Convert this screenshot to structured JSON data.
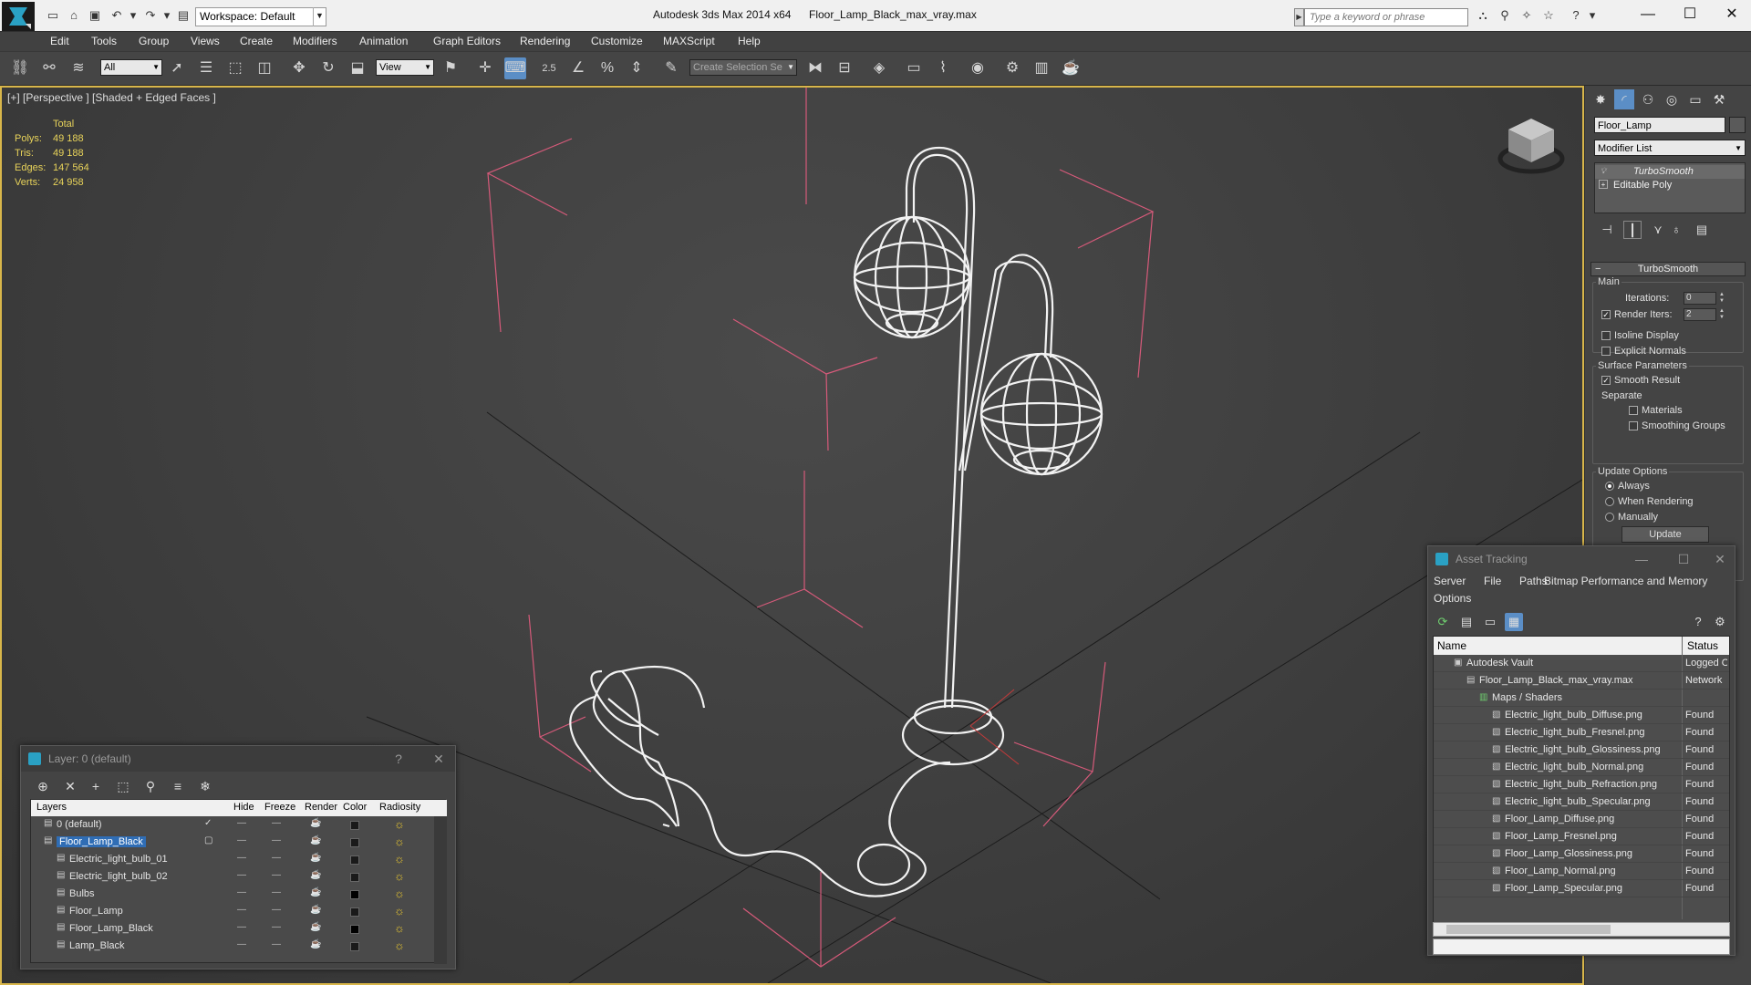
{
  "window": {
    "app_title": "Autodesk 3ds Max  2014 x64",
    "file_title": "Floor_Lamp_Black_max_vray.max",
    "workspace": "Workspace: Default",
    "search_placeholder": "Type a keyword or phrase"
  },
  "menu": [
    "Edit",
    "Tools",
    "Group",
    "Views",
    "Create",
    "Modifiers",
    "Animation",
    "Graph Editors",
    "Rendering",
    "Customize",
    "MAXScript",
    "Help"
  ],
  "toolbar": {
    "selection_filter": "All",
    "ref_coord": "View",
    "snap_label": "2.5",
    "named_selection_placeholder": "Create Selection Se"
  },
  "viewport": {
    "label": "[+] [Perspective ] [Shaded + Edged Faces ]",
    "stats": {
      "header": "Total",
      "rows": [
        {
          "k": "Polys:",
          "v": "49 188"
        },
        {
          "k": "Tris:",
          "v": "49 188"
        },
        {
          "k": "Edges:",
          "v": "147 564"
        },
        {
          "k": "Verts:",
          "v": "24 958"
        }
      ]
    }
  },
  "command_panel": {
    "object_name": "Floor_Lamp",
    "modifier_list": "Modifier List",
    "stack": [
      "TurboSmooth",
      "Editable Poly"
    ],
    "turbosmooth": {
      "title": "TurboSmooth",
      "main_label": "Main",
      "iterations_label": "Iterations:",
      "iterations": "0",
      "render_iters_label": "Render Iters:",
      "render_iters": "2",
      "isoline": "Isoline Display",
      "explicit_normals": "Explicit Normals",
      "surface_params": "Surface Parameters",
      "smooth_result": "Smooth Result",
      "separate": "Separate",
      "materials": "Materials",
      "smoothing_groups": "Smoothing Groups",
      "update_options": "Update Options",
      "always": "Always",
      "when_rendering": "When Rendering",
      "manually": "Manually",
      "update_button": "Update"
    }
  },
  "layer_dialog": {
    "title": "Layer: 0 (default)",
    "help": "?",
    "columns": [
      "Layers",
      "Hide",
      "Freeze",
      "Render",
      "Color",
      "Radiosity"
    ],
    "rows": [
      {
        "name": "0 (default)",
        "level": 1,
        "swatch": "#1a1a1a"
      },
      {
        "name": "Floor_Lamp_Black",
        "level": 1,
        "swatch": "#1a1a1a",
        "selected": true
      },
      {
        "name": "Electric_light_bulb_01",
        "level": 2,
        "swatch": "#1a1a1a"
      },
      {
        "name": "Electric_light_bulb_02",
        "level": 2,
        "swatch": "#1a1a1a"
      },
      {
        "name": "Bulbs",
        "level": 2,
        "swatch": "#000000"
      },
      {
        "name": "Floor_Lamp",
        "level": 2,
        "swatch": "#1a1a1a"
      },
      {
        "name": "Floor_Lamp_Black",
        "level": 2,
        "swatch": "#000000"
      },
      {
        "name": "Lamp_Black",
        "level": 2,
        "swatch": "#1a1a1a"
      }
    ]
  },
  "asset_dialog": {
    "title": "Asset Tracking",
    "menu_row1": [
      "Server",
      "File",
      "Paths",
      "Bitmap Performance and Memory"
    ],
    "menu_row2": [
      "Options"
    ],
    "columns": [
      "Name",
      "Status"
    ],
    "rows": [
      {
        "name": "Autodesk Vault",
        "status": "Logged O",
        "level": 1
      },
      {
        "name": "Floor_Lamp_Black_max_vray.max",
        "status": "Network",
        "level": 2
      },
      {
        "name": "Maps / Shaders",
        "status": "",
        "level": 3
      },
      {
        "name": "Electric_light_bulb_Diffuse.png",
        "status": "Found",
        "level": 4
      },
      {
        "name": "Electric_light_bulb_Fresnel.png",
        "status": "Found",
        "level": 4
      },
      {
        "name": "Electric_light_bulb_Glossiness.png",
        "status": "Found",
        "level": 4
      },
      {
        "name": "Electric_light_bulb_Normal.png",
        "status": "Found",
        "level": 4
      },
      {
        "name": "Electric_light_bulb_Refraction.png",
        "status": "Found",
        "level": 4
      },
      {
        "name": "Electric_light_bulb_Specular.png",
        "status": "Found",
        "level": 4
      },
      {
        "name": "Floor_Lamp_Diffuse.png",
        "status": "Found",
        "level": 4
      },
      {
        "name": "Floor_Lamp_Fresnel.png",
        "status": "Found",
        "level": 4
      },
      {
        "name": "Floor_Lamp_Glossiness.png",
        "status": "Found",
        "level": 4
      },
      {
        "name": "Floor_Lamp_Normal.png",
        "status": "Found",
        "level": 4
      },
      {
        "name": "Floor_Lamp_Specular.png",
        "status": "Found",
        "level": 4
      }
    ]
  },
  "colors": {
    "viewport_border": "#d8b64a",
    "stats_text": "#e8d35a",
    "selection": "#2f6db5",
    "bounding_box": "#d65a7a"
  }
}
